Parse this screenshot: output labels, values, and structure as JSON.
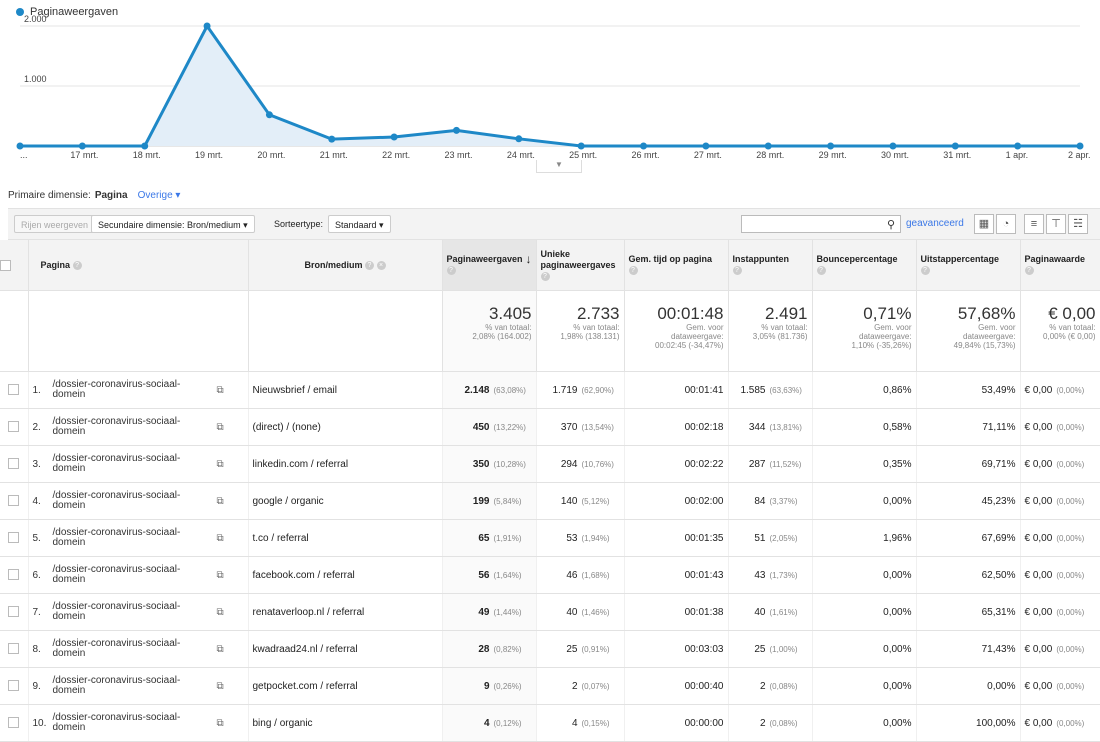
{
  "chart_data": {
    "type": "line",
    "legend": "Paginaweergaven",
    "series": [
      {
        "name": "Paginaweergaven",
        "values": [
          0,
          0,
          0,
          2000,
          520,
          115,
          150,
          260,
          120,
          0,
          0,
          0,
          0,
          0,
          0,
          0,
          0,
          0
        ]
      }
    ],
    "x": [
      "...",
      "17 mrt.",
      "18 mrt.",
      "19 mrt.",
      "20 mrt.",
      "21 mrt.",
      "22 mrt.",
      "23 mrt.",
      "24 mrt.",
      "25 mrt.",
      "26 mrt.",
      "27 mrt.",
      "28 mrt.",
      "29 mrt.",
      "30 mrt.",
      "31 mrt.",
      "1 apr.",
      "2 apr."
    ],
    "yticks": [
      "2.000",
      "1.000"
    ],
    "ylim": [
      0,
      2300
    ],
    "color": "#1e88c7",
    "grid": true
  },
  "dimension": {
    "label": "Primaire dimensie:",
    "active": "Pagina",
    "other": "Overige"
  },
  "toolbar": {
    "rows_button": "Rijen weergeven",
    "secondary": "Secundaire dimensie: Bron/medium",
    "sort_label": "Sorteertype:",
    "sort_value": "Standaard",
    "search_value": "",
    "advanced": "geavanceerd"
  },
  "headers": {
    "page": "Pagina",
    "source": "Bron/medium",
    "pageviews": "Paginaweergaven",
    "unique": "Unieke paginaweergaves",
    "avg_time": "Gem. tijd op pagina",
    "entrances": "Instappunten",
    "bounce": "Bouncepercentage",
    "exit": "Uitstappercentage",
    "value": "Paginawaarde"
  },
  "totals": {
    "pageviews": {
      "value": "3.405",
      "l1": "% van totaal:",
      "l2": "2,08% (164.002)"
    },
    "unique": {
      "value": "2.733",
      "l1": "% van totaal:",
      "l2": "1,98% (138.131)"
    },
    "avg_time": {
      "value": "00:01:48",
      "l1": "Gem. voor",
      "l2": "dataweergave:",
      "l3": "00:02:45 (-34,47%)"
    },
    "entrances": {
      "value": "2.491",
      "l1": "% van totaal:",
      "l2": "3,05% (81.736)"
    },
    "bounce": {
      "value": "0,71%",
      "l1": "Gem. voor",
      "l2": "dataweergave:",
      "l3": "1,10% (-35,26%)"
    },
    "exit": {
      "value": "57,68%",
      "l1": "Gem. voor",
      "l2": "dataweergave:",
      "l3": "49,84% (15,73%)"
    },
    "value": {
      "value": "€ 0,00",
      "l1": "% van totaal:",
      "l2": "0,00% (€ 0,00)"
    }
  },
  "rows": [
    {
      "idx": "1.",
      "page": "/dossier-coronavirus-sociaal-domein",
      "source": "Nieuwsbrief / email",
      "pv": "2.148",
      "pv_pct": "(63,08%)",
      "upv": "1.719",
      "upv_pct": "(62,90%)",
      "time": "00:01:41",
      "ent": "1.585",
      "ent_pct": "(63,63%)",
      "bounce": "0,86%",
      "exit": "53,49%",
      "val": "€ 0,00",
      "val_pct": "(0,00%)"
    },
    {
      "idx": "2.",
      "page": "/dossier-coronavirus-sociaal-domein",
      "source": "(direct) / (none)",
      "pv": "450",
      "pv_pct": "(13,22%)",
      "upv": "370",
      "upv_pct": "(13,54%)",
      "time": "00:02:18",
      "ent": "344",
      "ent_pct": "(13,81%)",
      "bounce": "0,58%",
      "exit": "71,11%",
      "val": "€ 0,00",
      "val_pct": "(0,00%)"
    },
    {
      "idx": "3.",
      "page": "/dossier-coronavirus-sociaal-domein",
      "source": "linkedin.com / referral",
      "pv": "350",
      "pv_pct": "(10,28%)",
      "upv": "294",
      "upv_pct": "(10,76%)",
      "time": "00:02:22",
      "ent": "287",
      "ent_pct": "(11,52%)",
      "bounce": "0,35%",
      "exit": "69,71%",
      "val": "€ 0,00",
      "val_pct": "(0,00%)"
    },
    {
      "idx": "4.",
      "page": "/dossier-coronavirus-sociaal-domein",
      "source": "google / organic",
      "pv": "199",
      "pv_pct": "(5,84%)",
      "upv": "140",
      "upv_pct": "(5,12%)",
      "time": "00:02:00",
      "ent": "84",
      "ent_pct": "(3,37%)",
      "bounce": "0,00%",
      "exit": "45,23%",
      "val": "€ 0,00",
      "val_pct": "(0,00%)"
    },
    {
      "idx": "5.",
      "page": "/dossier-coronavirus-sociaal-domein",
      "source": "t.co / referral",
      "pv": "65",
      "pv_pct": "(1,91%)",
      "upv": "53",
      "upv_pct": "(1,94%)",
      "time": "00:01:35",
      "ent": "51",
      "ent_pct": "(2,05%)",
      "bounce": "1,96%",
      "exit": "67,69%",
      "val": "€ 0,00",
      "val_pct": "(0,00%)"
    },
    {
      "idx": "6.",
      "page": "/dossier-coronavirus-sociaal-domein",
      "source": "facebook.com / referral",
      "pv": "56",
      "pv_pct": "(1,64%)",
      "upv": "46",
      "upv_pct": "(1,68%)",
      "time": "00:01:43",
      "ent": "43",
      "ent_pct": "(1,73%)",
      "bounce": "0,00%",
      "exit": "62,50%",
      "val": "€ 0,00",
      "val_pct": "(0,00%)"
    },
    {
      "idx": "7.",
      "page": "/dossier-coronavirus-sociaal-domein",
      "source": "renataverloop.nl / referral",
      "pv": "49",
      "pv_pct": "(1,44%)",
      "upv": "40",
      "upv_pct": "(1,46%)",
      "time": "00:01:38",
      "ent": "40",
      "ent_pct": "(1,61%)",
      "bounce": "0,00%",
      "exit": "65,31%",
      "val": "€ 0,00",
      "val_pct": "(0,00%)"
    },
    {
      "idx": "8.",
      "page": "/dossier-coronavirus-sociaal-domein",
      "source": "kwadraad24.nl / referral",
      "pv": "28",
      "pv_pct": "(0,82%)",
      "upv": "25",
      "upv_pct": "(0,91%)",
      "time": "00:03:03",
      "ent": "25",
      "ent_pct": "(1,00%)",
      "bounce": "0,00%",
      "exit": "71,43%",
      "val": "€ 0,00",
      "val_pct": "(0,00%)"
    },
    {
      "idx": "9.",
      "page": "/dossier-coronavirus-sociaal-domein",
      "source": "getpocket.com / referral",
      "pv": "9",
      "pv_pct": "(0,26%)",
      "upv": "2",
      "upv_pct": "(0,07%)",
      "time": "00:00:40",
      "ent": "2",
      "ent_pct": "(0,08%)",
      "bounce": "0,00%",
      "exit": "0,00%",
      "val": "€ 0,00",
      "val_pct": "(0,00%)"
    },
    {
      "idx": "10.",
      "page": "/dossier-coronavirus-sociaal-domein",
      "source": "bing / organic",
      "pv": "4",
      "pv_pct": "(0,12%)",
      "upv": "4",
      "upv_pct": "(0,15%)",
      "time": "00:00:00",
      "ent": "2",
      "ent_pct": "(0,08%)",
      "bounce": "0,00%",
      "exit": "100,00%",
      "val": "€ 0,00",
      "val_pct": "(0,00%)"
    }
  ]
}
